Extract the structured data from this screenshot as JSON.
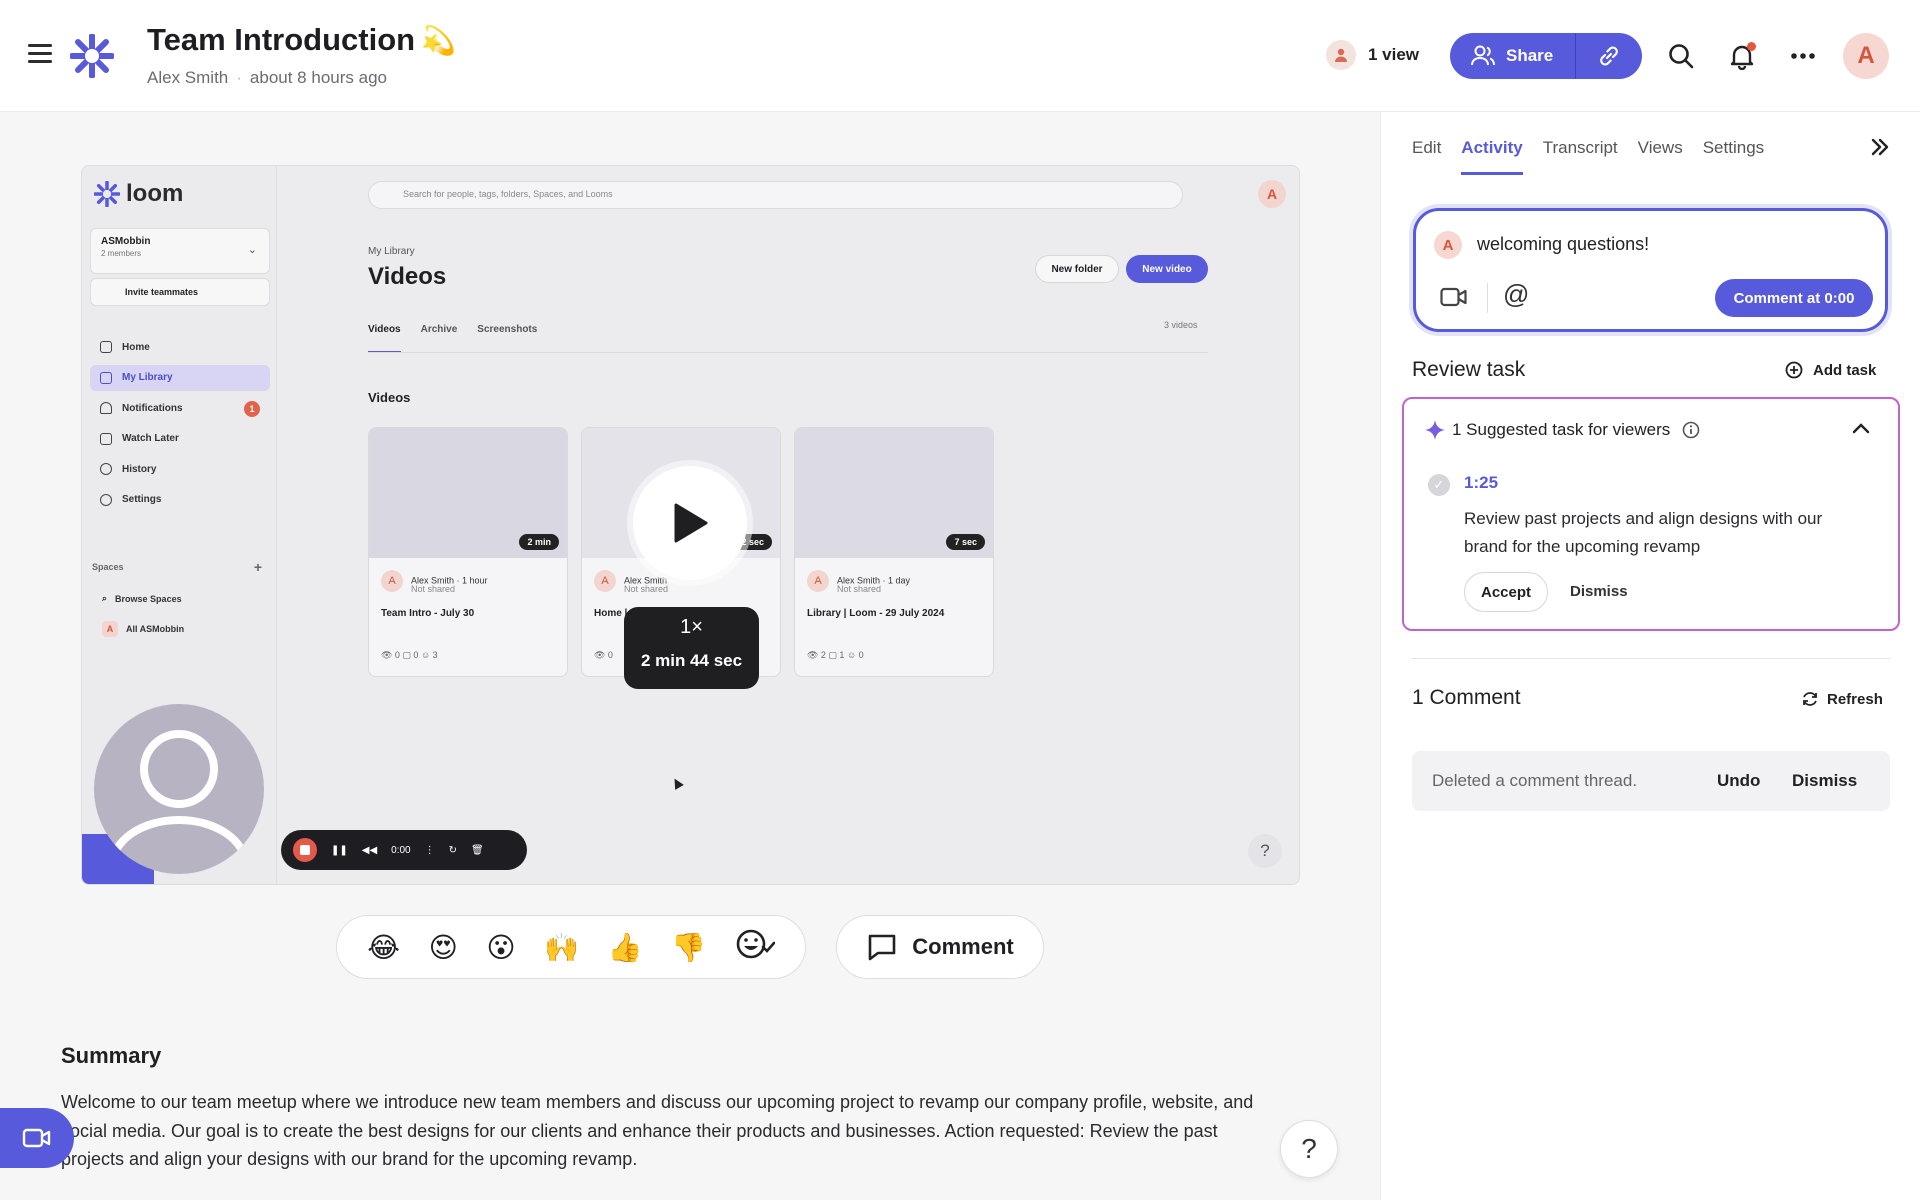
{
  "header": {
    "title": "Team Introduction",
    "title_emoji": "💫",
    "author": "Alex Smith",
    "timestamp": "about 8 hours ago",
    "views": "1 view",
    "share_label": "Share",
    "avatar_initial": "A"
  },
  "player": {
    "recording": {
      "app_name": "loom",
      "workspace_name": "ASMobbin",
      "workspace_members": "2 members",
      "invite_label": "Invite teammates",
      "nav": [
        {
          "label": "Home"
        },
        {
          "label": "My Library"
        },
        {
          "label": "Notifications",
          "badge": "1"
        },
        {
          "label": "Watch Later"
        },
        {
          "label": "History"
        },
        {
          "label": "Settings"
        }
      ],
      "spaces_label": "Spaces",
      "browse_spaces": "Browse Spaces",
      "all_spaces": "All ASMobbin",
      "search_placeholder": "Search for people, tags, folders, Spaces, and Looms",
      "avatar_initial": "A",
      "breadcrumb": "My Library",
      "page_title": "Videos",
      "new_folder": "New folder",
      "new_video": "New video",
      "tabs": [
        "Videos",
        "Archive",
        "Screenshots"
      ],
      "count": "3 videos",
      "section_title": "Videos",
      "cards": [
        {
          "duration": "2 min",
          "author": "Alex Smith",
          "age": "· 1 hour",
          "shared": "Not shared",
          "title": "Team Intro - July 30",
          "stats": "👁 0   ▢ 0   ☺ 3"
        },
        {
          "duration": "2 sec",
          "author": "Alex Smith",
          "age": "",
          "shared": "Not shared",
          "title": "Home |",
          "stats": "👁 0"
        },
        {
          "duration": "7 sec",
          "author": "Alex Smith",
          "age": "· 1 day",
          "shared": "Not shared",
          "title": "Library | Loom - 29 July 2024",
          "stats": "👁 2   ▢ 1   ☺ 0"
        }
      ],
      "rec_time": "0:00"
    },
    "speed": "1×",
    "length": "2 min 44 sec"
  },
  "reactions": [
    "😂",
    "😍",
    "😮",
    "🙌",
    "👍",
    "👎"
  ],
  "comment_button": "Comment",
  "summary": {
    "heading": "Summary",
    "body": "Welcome to our team meetup where we introduce new team members and discuss our upcoming project to revamp our company profile, website, and social media. Our goal is to create the best designs for our clients and enhance their products and businesses. Action requested: Review the past projects and align your designs with our brand for the upcoming revamp."
  },
  "sidebar": {
    "tabs": [
      "Edit",
      "Activity",
      "Transcript",
      "Views",
      "Settings"
    ],
    "active_tab": "Activity",
    "comment_box": {
      "avatar_initial": "A",
      "value": "welcoming questions!",
      "submit_label": "Comment at 0:00"
    },
    "review": {
      "heading": "Review task",
      "add_task": "Add task",
      "suggested_header": "1 Suggested task for viewers",
      "task_time": "1:25",
      "task_desc": "Review past projects and align designs with our brand for the upcoming revamp",
      "accept": "Accept",
      "dismiss": "Dismiss"
    },
    "comments": {
      "heading": "1 Comment",
      "refresh": "Refresh",
      "deleted_msg": "Deleted a comment thread.",
      "undo": "Undo",
      "dismiss": "Dismiss"
    }
  },
  "colors": {
    "accent": "#565adb",
    "avatar_text": "#d5553d",
    "task_border": "#c163cc"
  }
}
